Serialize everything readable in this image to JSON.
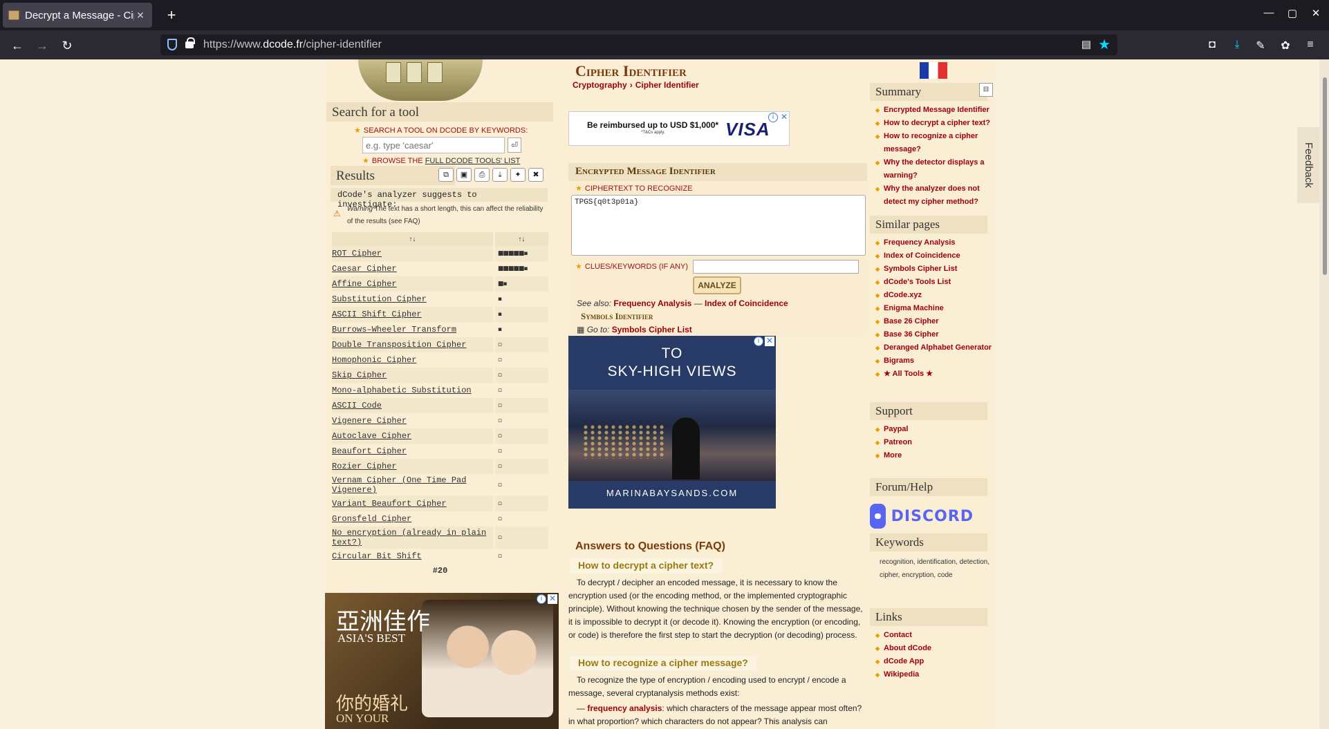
{
  "browser": {
    "tab_title": "Decrypt a Message - Cip",
    "new_tab": "+",
    "url_prefix": "https://www.",
    "url_domain": "dcode.fr",
    "url_path": "/cipher-identifier"
  },
  "left": {
    "search_title": "Search for a tool",
    "search_note": "SEARCH A TOOL ON DCODE BY KEYWORDS:",
    "search_placeholder": "e.g. type 'caesar'",
    "browse_prefix": "BROWSE THE ",
    "browse_link": "FULL DCODE TOOLS' LIST",
    "results_title": "Results",
    "suggest": "dCode's analyzer suggests to investigate:",
    "warning_label": "Warning",
    "warning_text": "The text has a short length, this can affect the reliability of the results (see FAQ)",
    "col1_header": "↑↓",
    "col2_header": "↑↓",
    "results": [
      {
        "name": "ROT Cipher",
        "score": "■■■■■▪"
      },
      {
        "name": "Caesar Cipher",
        "score": "■■■■■▪"
      },
      {
        "name": "Affine Cipher",
        "score": "■▪"
      },
      {
        "name": "Substitution Cipher",
        "score": "▪"
      },
      {
        "name": "ASCII Shift Cipher",
        "score": "▪"
      },
      {
        "name": "Burrows–Wheeler Transform",
        "score": "▪"
      },
      {
        "name": "Double Transposition Cipher",
        "score": "▫"
      },
      {
        "name": "Homophonic Cipher",
        "score": "▫"
      },
      {
        "name": "Skip Cipher",
        "score": "▫"
      },
      {
        "name": "Mono-alphabetic Substitution",
        "score": "▫"
      },
      {
        "name": "ASCII Code",
        "score": "▫"
      },
      {
        "name": "Vigenere Cipher",
        "score": "▫"
      },
      {
        "name": "Autoclave Cipher",
        "score": "▫"
      },
      {
        "name": "Beaufort Cipher",
        "score": "▫"
      },
      {
        "name": "Rozier Cipher",
        "score": "▫"
      },
      {
        "name": "Vernam Cipher (One Time Pad Vigenere)",
        "score": "▫"
      },
      {
        "name": "Variant Beaufort Cipher",
        "score": "▫"
      },
      {
        "name": "Gronsfeld Cipher",
        "score": "▫"
      },
      {
        "name": "No encryption (already in plain text?)",
        "score": "▫"
      },
      {
        "name": "Circular Bit Shift",
        "score": "▫"
      }
    ],
    "total": "#20",
    "ad_zh": "亞洲佳作",
    "ad_en": "ASIA'S BEST",
    "ad_zh2": "你的婚礼",
    "ad_en2": "ON YOUR"
  },
  "main": {
    "title": "Cipher Identifier",
    "crumb1": "Cryptography",
    "crumb_sep": "›",
    "crumb2": "Cipher Identifier",
    "visa_text": "Be reimbursed up to USD $1,000*",
    "visa_sub": "*T&Cs apply.",
    "visa_brand": "VISA",
    "emi_title": "Encrypted Message Identifier",
    "cipher_label": "CIPHERTEXT TO RECOGNIZE",
    "cipher_value": "TPGS{q0t3p01a}",
    "clues_label": "CLUES/KEYWORDS (IF ANY)",
    "analyze": "ANALYZE",
    "seealso_label": "See also:",
    "seealso_1": "Frequency Analysis",
    "seealso_dash": " — ",
    "seealso_2": "Index of Coincidence",
    "symbols_id": "Symbols Identifier",
    "goto_label": "Go to:",
    "goto_link": "Symbols Cipher List",
    "mbs_l1": "TO",
    "mbs_l2": "SKY-HIGH VIEWS",
    "mbs_foot": "MARINABAYSANDS.COM",
    "faq_title": "Answers to Questions (FAQ)",
    "faq_q1": "How to decrypt a cipher text?",
    "faq_a1": "To decrypt / decipher an encoded message, it is necessary to know the encryption used (or the encoding method, or the implemented cryptographic principle). Without knowing the technique chosen by the sender of the message, it is impossible to decrypt it (or decode it). Knowing the encryption (or encoding, or code) is therefore the first step to start the decryption (or decoding) process.",
    "faq_q2": "How to recognize a cipher message?",
    "faq_a2": "To recognize the type of encryption / encoding used to encrypt / encode a message, several cryptanalysis methods exist:",
    "faq_a3_prefix": "— ",
    "faq_a3_link": "frequency analysis",
    "faq_a3_rest": ": which characters of the message appear most often? in what proportion? which characters do not appear? This analysis can"
  },
  "right": {
    "summary_title": "Summary",
    "summary_toggle": "⊟",
    "summary_items": [
      "Encrypted Message Identifier",
      "How to decrypt a cipher text?",
      "How to recognize a cipher message?",
      "Why the detector displays a warning?",
      "Why the analyzer does not detect my cipher method?"
    ],
    "similar_title": "Similar pages",
    "similar_items": [
      "Frequency Analysis",
      "Index of Coincidence",
      "Symbols Cipher List",
      "dCode's Tools List",
      "dCode.xyz",
      "Enigma Machine",
      "Base 26 Cipher",
      "Base 36 Cipher",
      "Deranged Alphabet Generator",
      "Bigrams",
      "★ All Tools ★"
    ],
    "support_title": "Support",
    "support_items": [
      "Paypal",
      "Patreon",
      "More"
    ],
    "forum_title": "Forum/Help",
    "discord": "DISCORD",
    "keywords_title": "Keywords",
    "keywords_text": "recognition, identification, detection, cipher, encryption, code",
    "links_title": "Links",
    "links_items": [
      "Contact",
      "About dCode",
      "dCode App",
      "Wikipedia"
    ]
  },
  "feedback": "Feedback"
}
